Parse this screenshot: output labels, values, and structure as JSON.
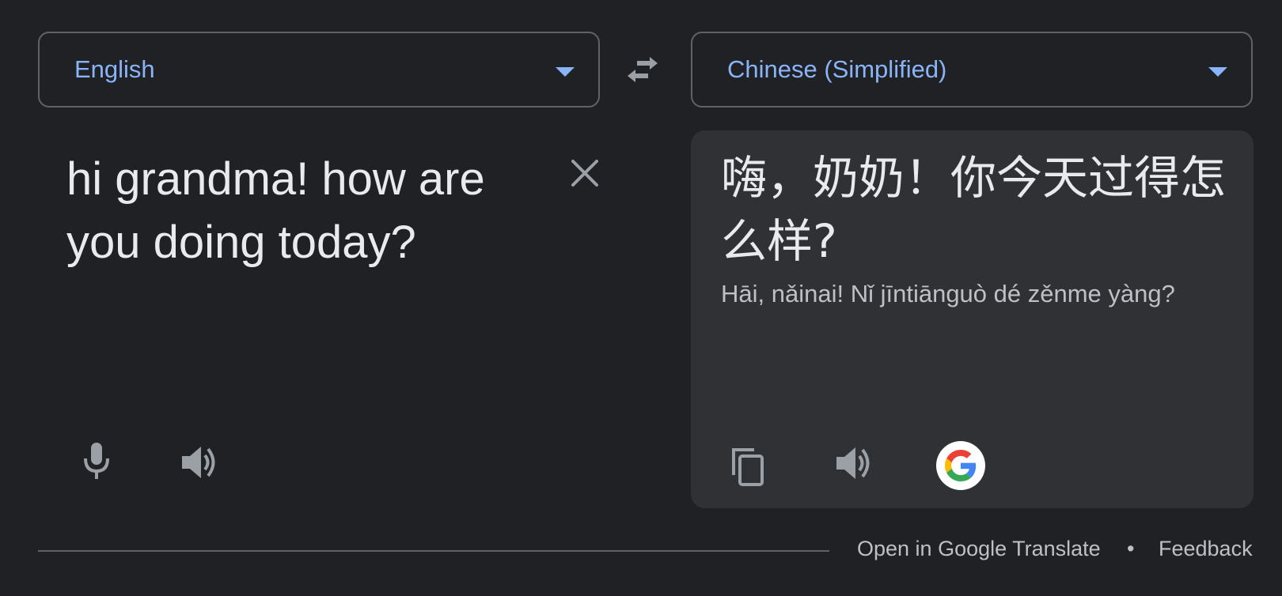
{
  "source_language": {
    "label": "English",
    "icon": "dropdown-caret-icon"
  },
  "target_language": {
    "label": "Chinese (Simplified)",
    "icon": "dropdown-caret-icon"
  },
  "swap": {
    "icon": "swap-arrows-icon"
  },
  "source": {
    "text": "hi grandma! how are you doing today?",
    "clear_icon": "close-icon",
    "mic_icon": "microphone-icon",
    "speak_icon": "speaker-icon"
  },
  "target": {
    "text": "嗨，奶奶！你今天过得怎么样?",
    "romanization": "Hāi, nǎinai! Nǐ jīntiānguò dé zěnme yàng?",
    "copy_icon": "copy-icon",
    "speak_icon": "speaker-icon",
    "google_icon": "google-g-icon"
  },
  "footer": {
    "open_link": "Open in Google Translate",
    "separator": "•",
    "feedback_link": "Feedback"
  },
  "colors": {
    "background": "#202124",
    "panel": "#303134",
    "accent": "#8ab4f8",
    "text": "#e8eaed",
    "muted": "#bdc1c6",
    "icon": "#9aa0a6",
    "border": "#5f6368"
  }
}
